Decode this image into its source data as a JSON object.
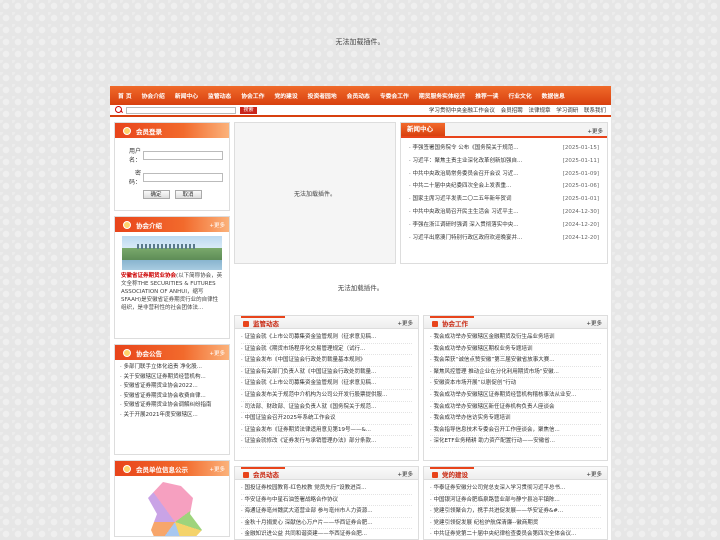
{
  "top_notice": "无法加载插件。",
  "nav": [
    "首 页",
    "协会介绍",
    "新闻中心",
    "监管动态",
    "协会工作",
    "党的建设",
    "投资者园地",
    "会员动态",
    "专委会工作",
    "期货服务实体经济",
    "推荐一读",
    "行业文化",
    "数据信息"
  ],
  "search": {
    "button": "搜索",
    "links": [
      "学习贯彻中央金融工作会议",
      "会员招聘",
      "法律规章",
      "学习调研",
      "联系我们"
    ]
  },
  "login": {
    "title": "会员登录",
    "user_label": "用户名：",
    "pass_label": "密　码：",
    "login_btn": "确定",
    "cancel_btn": "取消"
  },
  "intro": {
    "title": "协会介绍",
    "more": "更多",
    "highlight": "安徽省证券期货业协会",
    "text": "(以下简称协会，英文全称THE SECURITIES & FUTURES ASSOCIATION OF ANHUI，缩写SFAAH)是安徽省证券期货行业的自律性组织，是非营利性的社会团体法..."
  },
  "notice": {
    "title": "协会公告",
    "more": "更多",
    "items": [
      "多部门联手立体化追责 净化股...",
      "关于安徽辖区证券期货经营机构...",
      "安徽省证券期货业协会2022...",
      "安徽省证券期货业协会收费自律...",
      "安徽省证券期货业协会调解纠纷指南",
      "关于开展2021年度安徽辖区..."
    ]
  },
  "member_info": {
    "title": "会员单位信息公示",
    "more": "更多"
  },
  "center_plugin": "无法加载插件。",
  "news": {
    "title": "新闻中心",
    "more": "更多",
    "items": [
      {
        "t": "李强签署国务院令 公布《国务院关于规范...",
        "d": "[2025-01-15]"
      },
      {
        "t": "习近平：聚焦主责主业深化改革创新加强自...",
        "d": "[2025-01-11]"
      },
      {
        "t": "中共中央政治局常务委员会召开会议 习近...",
        "d": "[2025-01-09]"
      },
      {
        "t": "中共二十届中央纪委四次全会上发表重...",
        "d": "[2025-01-06]"
      },
      {
        "t": "国家主席习近平发表二〇二五年新年贺词",
        "d": "[2025-01-01]"
      },
      {
        "t": "中共中央政治局召开民主生活会 习近平主...",
        "d": "[2024-12-30]"
      },
      {
        "t": "李强在浙江调研时强调 深入贯彻落实中央...",
        "d": "[2024-12-20]"
      },
      {
        "t": "习近平出席澳门特别行政区政府欢迎晚宴并...",
        "d": "[2024-12-20]"
      }
    ]
  },
  "mid_plugin": "无法加载插件。",
  "regulation": {
    "title": "监管动态",
    "more": "更多",
    "items": [
      "证监会就《上市公司募集资金监管规则（征求意见稿...",
      "证监会就《期货市场程序化交易管理规定（试行...",
      "证监会发布《中国证监会行政处罚裁量基本规则》",
      "证监会有关部门负责人就《中国证监会行政处罚裁量...",
      "证监会就《上市公司募集资金监管规则（征求意见稿...",
      "证监会发布关于规范中介机构为公司公开发行股票提供服...",
      "司法部、财政部、证监会负责人就《国务院关于规范...",
      "中国证监会召开2025年系统工作会议",
      "证监会发布《证券期货法律适用意见第19号——&...",
      "证监会就修改《证券发行与承销管理办法》部分条款..."
    ]
  },
  "work": {
    "title": "协会工作",
    "more": "更多",
    "items": [
      "我会成功举办安徽辖区金融期货及衍生品业务培训",
      "我会成功举办安徽辖区期权业务专题培训",
      "我会荣获“诚信点赞安徽”第三届安徽省放事大赛...",
      "聚焦风控管理 推动企业在分化利用期货市场“安徽...",
      "安徽资本市场开展“以剧促创”行动",
      "我会成功举办安徽辖区证券期货经营机构稽核事法从业安...",
      "我会成功举办安徽辖区新任证券机构负责人座谈会",
      "我会成功举办信访实务专题培训",
      "我会指导信息技术专委会召开工作座谈会，聚焦信...",
      "深化ETF业务精耕 助力资产配置行动——安徽省..."
    ]
  },
  "member_news": {
    "title": "会员动态",
    "more": "更多",
    "items": [
      "国投证券校园教育-红色校教 党员先行”设教进百...",
      "华安证券与中星石油签署战略合作协议",
      "海通证券亳州魏武大道营业部 参与亳州市人力资源...",
      "金秋十月捐爱心 深献信心万户片——华西证券合肥...",
      "金融知识进公益 共同和谐资建——华西证券合肥..."
    ]
  },
  "party": {
    "title": "党的建设",
    "more": "更多",
    "items": [
      "华泰证券安徽分公司党总支深入学习贯彻习近平总书...",
      "中国银河证券合肥临泉路营业部与静宁县冶平镇陈...",
      "党建引领聚合力，携手共进促发展——华安证券&#...",
      "党建引领促发展 纪检护航保清廉--徽商期货",
      "中共证券党第二十届中央纪律检查委员会第四次全体会议..."
    ]
  }
}
